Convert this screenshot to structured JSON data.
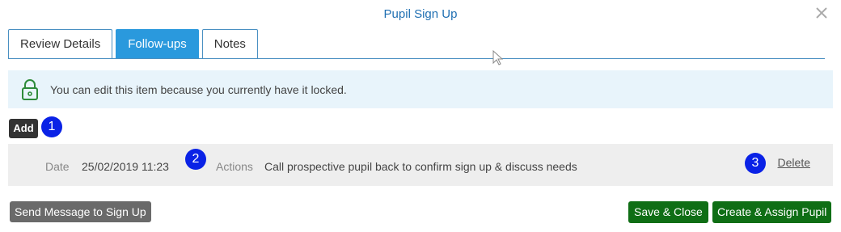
{
  "dialog": {
    "title": "Pupil Sign Up"
  },
  "tabs": [
    {
      "label": "Review Details",
      "active": false
    },
    {
      "label": "Follow-ups",
      "active": true
    },
    {
      "label": "Notes",
      "active": false
    }
  ],
  "lock_banner": {
    "text": "You can edit this item because you currently have it locked.",
    "icon": "lock-icon",
    "icon_color": "#2e8b3a"
  },
  "toolbar": {
    "add_label": "Add"
  },
  "markers": [
    "1",
    "2",
    "3"
  ],
  "followup": {
    "date_label": "Date",
    "date_value": "25/02/2019 11:23",
    "actions_label": "Actions",
    "actions_value": "Call prospective pupil back to confirm sign up & discuss needs",
    "delete_label": "Delete"
  },
  "footer": {
    "send_label": "Send Message to Sign Up",
    "save_label": "Save & Close",
    "create_label": "Create & Assign Pupil"
  },
  "colors": {
    "accent": "#2a99dd",
    "title": "#1f6fb2",
    "banner_bg": "#e8f4fb",
    "success": "#0f6e15",
    "marker": "#0a22e6"
  }
}
